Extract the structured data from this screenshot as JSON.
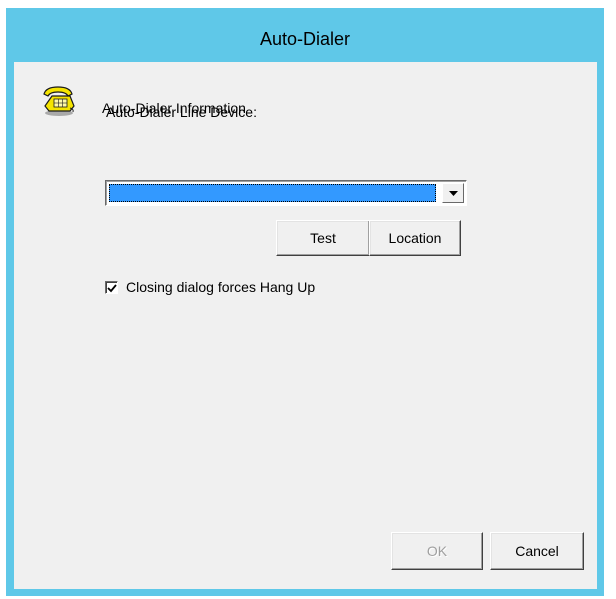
{
  "window": {
    "title": "Auto-Dialer"
  },
  "header": {
    "title": "Auto-Dialer Information",
    "icon": "telephone-icon"
  },
  "line_device": {
    "label": "Auto-Dialer Line Device:",
    "selected_value": "",
    "highlight_color": "#3399ff"
  },
  "buttons": {
    "test": "Test",
    "location": "Location",
    "ok": "OK",
    "cancel": "Cancel"
  },
  "options": {
    "hang_up_label": "Closing dialog forces Hang Up",
    "hang_up_checked": true
  },
  "colors": {
    "titlebar": "#5fc8e8",
    "client": "#f0f0f0"
  }
}
